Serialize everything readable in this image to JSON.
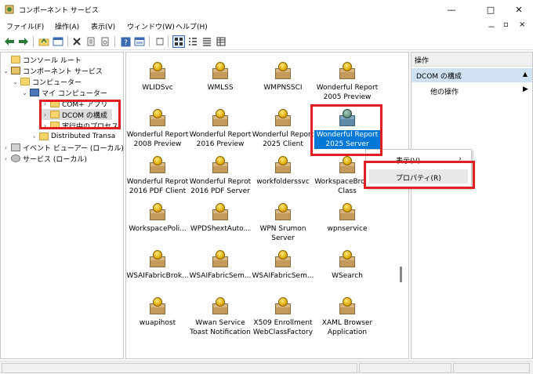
{
  "window": {
    "title": "コンポーネント サービス"
  },
  "menu": {
    "items": [
      "ファイル(F)",
      "操作(A)",
      "表示(V)",
      "ウィンドウ(W)",
      "ヘルプ(H)"
    ],
    "right_minimize": "－",
    "right_restore": "▫",
    "right_close": "×"
  },
  "titlebar_buttons": {
    "minimize": "—",
    "maximize": "□",
    "close": "✕"
  },
  "tree": {
    "root": "コンソール ルート",
    "component_services": "コンポーネント サービス",
    "computers": "コンピューター",
    "my_computer": "マイ コンピューター",
    "com_apps": "COM+ アプリ",
    "dcom_config": "DCOM の構成",
    "running_processes": "実行中のプロセス",
    "distributed_tx": "Distributed Transa",
    "event_viewer": "イベント ビューアー (ローカル)",
    "services": "サービス (ローカル)"
  },
  "items": [
    {
      "label": "WLIDSvc"
    },
    {
      "label": "WMLSS"
    },
    {
      "label": "WMPNSSCI"
    },
    {
      "label": "Wonderful Report 2005 Preview"
    },
    {
      "label": "Wonderful Report 2008 Preview"
    },
    {
      "label": "Wonderful Report 2016 Preview"
    },
    {
      "label": "Wonderful Report 2025 Client"
    },
    {
      "label": "Wonderful Report 2025 Server",
      "selected": true
    },
    {
      "label": "Wonderful Reprot 2016 PDF Client"
    },
    {
      "label": "Wonderful Reprot 2016 PDF Server"
    },
    {
      "label": "workfolderssvc"
    },
    {
      "label": "WorkspaceBroke... Class"
    },
    {
      "label": "WorkspacePoli..."
    },
    {
      "label": "WPDShextAuto..."
    },
    {
      "label": "WPN Srumon Server"
    },
    {
      "label": "wpnservice"
    },
    {
      "label": "WSAIFabricBrok..."
    },
    {
      "label": "WSAIFabricSem..."
    },
    {
      "label": "WSAIFabricSem..."
    },
    {
      "label": "WSearch"
    },
    {
      "label": "wuapihost"
    },
    {
      "label": "Wwan Service Toast Notification"
    },
    {
      "label": "X509 Enrollment WebClassFactory"
    },
    {
      "label": "XAML Browser Application"
    }
  ],
  "actions": {
    "header": "操作",
    "selected": "DCOM の構成",
    "other": "他の操作"
  },
  "context_menu": {
    "view": "表示(V)",
    "properties": "プロパティ(R)"
  },
  "colors": {
    "highlight": "#e02020",
    "selection": "#0078d7"
  }
}
